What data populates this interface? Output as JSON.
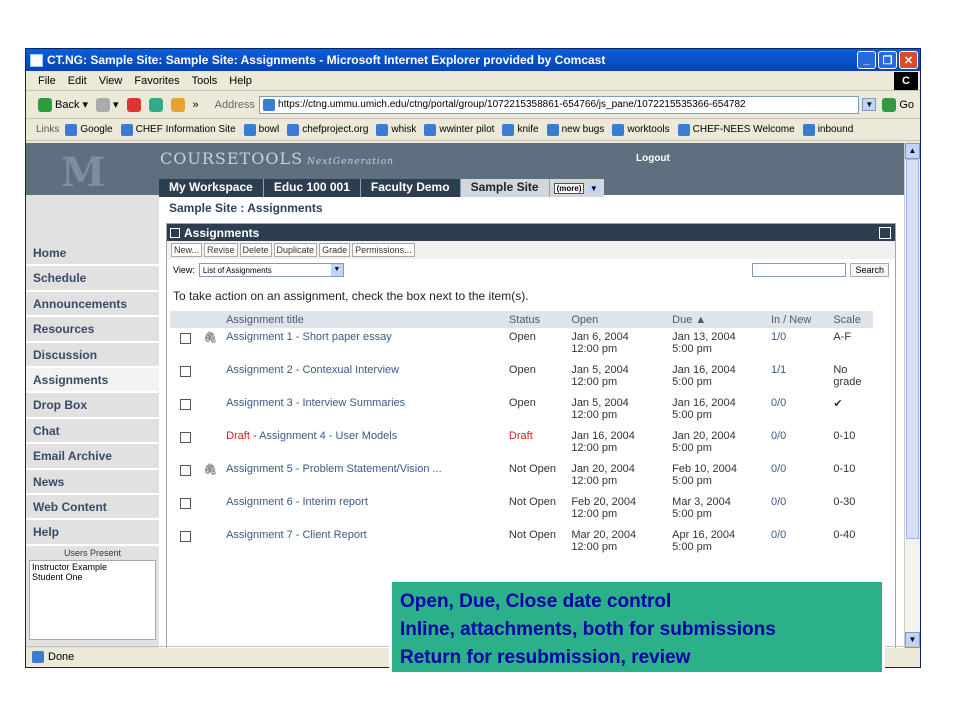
{
  "window": {
    "title": "CT.NG: Sample Site: Sample Site: Assignments - Microsoft Internet Explorer provided by Comcast",
    "status": "Done"
  },
  "menu": [
    "File",
    "Edit",
    "View",
    "Favorites",
    "Tools",
    "Help"
  ],
  "toolbar": {
    "back": "Back",
    "address_label": "Address",
    "url": "https://ctng.ummu.umich.edu/ctng/portal/group/1072215358861-654766/js_pane/1072215535366-654782",
    "go": "Go"
  },
  "links": {
    "label": "Links",
    "items": [
      "Google",
      "CHEF Information Site",
      "bowl",
      "chefproject.org",
      "whisk",
      "wwinter pilot",
      "knife",
      "new bugs",
      "worktools",
      "CHEF-NEES Welcome",
      "inbound"
    ]
  },
  "portal": {
    "logo_m": "M",
    "brand": "COURSETOOLS",
    "brand_sub": "NextGeneration",
    "logout": "Logout",
    "tabs": [
      "My Workspace",
      "Educ 100 001",
      "Faculty Demo",
      "Sample Site"
    ],
    "more": "(more)",
    "breadcrumb": "Sample Site : Assignments"
  },
  "nav": {
    "items": [
      "Home",
      "Schedule",
      "Announcements",
      "Resources",
      "Discussion",
      "Assignments",
      "Drop Box",
      "Chat",
      "Email Archive",
      "News",
      "Web Content",
      "Help"
    ],
    "users_header": "Users Present",
    "users": [
      "Instructor Example",
      "Student One"
    ]
  },
  "panel": {
    "title": "Assignments",
    "actions": [
      "New...",
      "Revise",
      "Delete",
      "Duplicate",
      "Grade",
      "Permissions..."
    ],
    "view_label": "View:",
    "view_value": "List of Assignments",
    "search_button": "Search",
    "instructions": "To take action on an assignment, check the box next to the item(s).",
    "columns": [
      "Assignment title",
      "Status",
      "Open",
      "Due",
      "In / New",
      "Scale"
    ],
    "rows": [
      {
        "title": "Assignment 1 - Short paper essay",
        "status": "Open",
        "open1": "Jan 6, 2004",
        "open2": "12:00 pm",
        "due1": "Jan 13, 2004",
        "due2": "5:00 pm",
        "innew": "1/0",
        "scale": "A-F"
      },
      {
        "title": "Assignment 2 - Contexual Interview",
        "status": "Open",
        "open1": "Jan 5, 2004",
        "open2": "12:00 pm",
        "due1": "Jan 16, 2004",
        "due2": "5:00 pm",
        "innew": "1/1",
        "scale": "No grade"
      },
      {
        "title": "Assignment 3 - Interview Summaries",
        "status": "Open",
        "open1": "Jan 5, 2004",
        "open2": "12:00 pm",
        "due1": "Jan 16, 2004",
        "due2": "5:00 pm",
        "innew": "0/0",
        "scale": "✔"
      },
      {
        "draft": "Draft -",
        "title": "Assignment 4 - User Models",
        "status": "Draft",
        "open1": "Jan 16, 2004",
        "open2": "12:00 pm",
        "due1": "Jan 20, 2004",
        "due2": "5:00 pm",
        "innew": "0/0",
        "scale": "0-10"
      },
      {
        "title": "Assignment 5 - Problem Statement/Vision ...",
        "status": "Not Open",
        "open1": "Jan 20, 2004",
        "open2": "12:00 pm",
        "due1": "Feb 10, 2004",
        "due2": "5:00 pm",
        "innew": "0/0",
        "scale": "0-10"
      },
      {
        "title": "Assignment 6 - Interim report",
        "status": "Not Open",
        "open1": "Feb 20, 2004",
        "open2": "12:00 pm",
        "due1": "Mar 3, 2004",
        "due2": "5:00 pm",
        "innew": "0/0",
        "scale": "0-30"
      },
      {
        "title": "Assignment 7 - Client Report",
        "status": "Not Open",
        "open1": "Mar 20, 2004",
        "open2": "12:00 pm",
        "due1": "Apr 16, 2004",
        "due2": "5:00 pm",
        "innew": "0/0",
        "scale": "0-40"
      }
    ]
  },
  "callout": [
    "Open, Due, Close date control",
    "Inline, attachments, both for submissions",
    "Return for resubmission, review"
  ]
}
